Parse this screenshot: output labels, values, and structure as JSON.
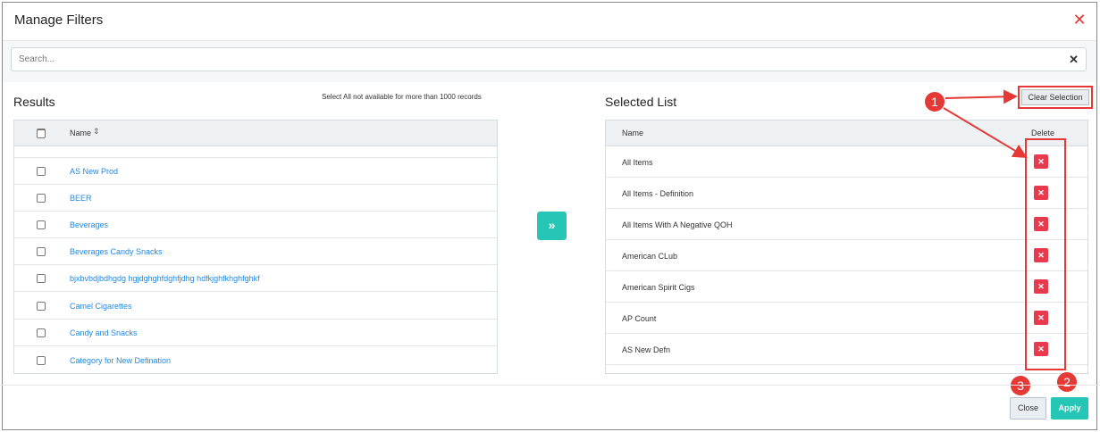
{
  "dialog": {
    "title": "Manage Filters",
    "close_icon": "close-icon"
  },
  "search": {
    "placeholder": "Search...",
    "clear_icon": "clear-icon"
  },
  "results": {
    "title": "Results",
    "note": "Select All not available for more than 1000 records",
    "column_name": "Name",
    "sort_icon": "sort-icon",
    "items": [
      "AS New Prod",
      "BEER",
      "Beverages",
      "Beverages Candy Snacks",
      "bjxbvbdjbdhgdg hgjdghghfdghfjdhg hdfkjghfkhghfghkf",
      "Camel Cigarettes",
      "Candy and Snacks",
      "Category for New Defination"
    ]
  },
  "move": {
    "icon": "double-chevron-right-icon"
  },
  "selected": {
    "title": "Selected List",
    "clear_label": "Clear Selection",
    "column_name": "Name",
    "column_delete": "Delete",
    "delete_icon": "delete-x-icon",
    "items": [
      "All Items",
      "All Items - Definition",
      "All Items With A Negative QOH",
      "American CLub",
      "American Spirit Cigs",
      "AP Count",
      "AS New Defn"
    ]
  },
  "footer": {
    "close_label": "Close",
    "apply_label": "Apply"
  },
  "callouts": [
    "1",
    "2",
    "3"
  ],
  "colors": {
    "accent_teal": "#26c6b6",
    "annotation_red": "#e53935",
    "delete_red": "#e8394d",
    "link_blue": "#1e88e5"
  }
}
